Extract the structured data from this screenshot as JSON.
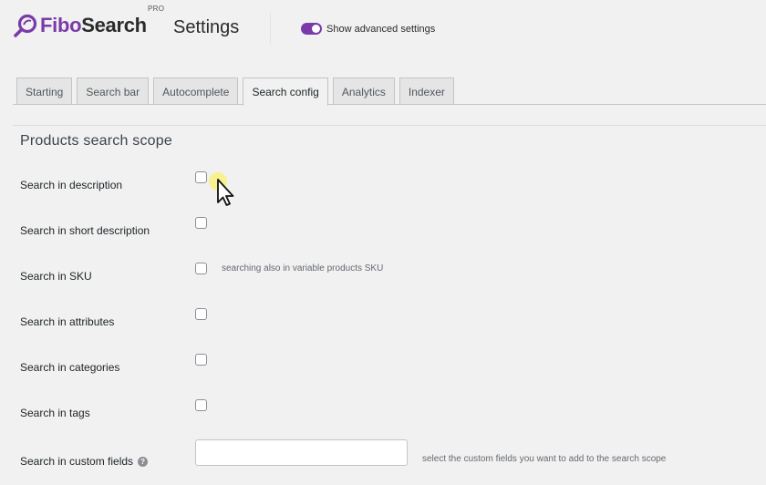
{
  "brand": {
    "name_part1": "Fibo",
    "name_part2": "Search",
    "edition": "PRO",
    "accent_color": "#7a3aa8"
  },
  "header": {
    "title": "Settings",
    "advanced_toggle": {
      "label": "Show advanced settings",
      "enabled": true
    }
  },
  "tabs": [
    {
      "label": "Starting",
      "active": false
    },
    {
      "label": "Search bar",
      "active": false
    },
    {
      "label": "Autocomplete",
      "active": false
    },
    {
      "label": "Search config",
      "active": true
    },
    {
      "label": "Analytics",
      "active": false
    },
    {
      "label": "Indexer",
      "active": false
    }
  ],
  "section": {
    "title": "Products search scope",
    "fields": [
      {
        "label": "Search in description",
        "type": "checkbox",
        "checked": false,
        "hint": ""
      },
      {
        "label": "Search in short description",
        "type": "checkbox",
        "checked": false,
        "hint": ""
      },
      {
        "label": "Search in SKU",
        "type": "checkbox",
        "checked": false,
        "hint": "searching also in variable products SKU"
      },
      {
        "label": "Search in attributes",
        "type": "checkbox",
        "checked": false,
        "hint": ""
      },
      {
        "label": "Search in categories",
        "type": "checkbox",
        "checked": false,
        "hint": ""
      },
      {
        "label": "Search in tags",
        "type": "checkbox",
        "checked": false,
        "hint": ""
      },
      {
        "label": "Search in custom fields",
        "type": "text",
        "value": "",
        "help_icon": "question-mark-icon",
        "hint": "select the custom fields you want to add to the search scope"
      }
    ]
  },
  "cursor": {
    "icon": "mouse-pointer-icon",
    "highlight_color": "#faf06e"
  }
}
